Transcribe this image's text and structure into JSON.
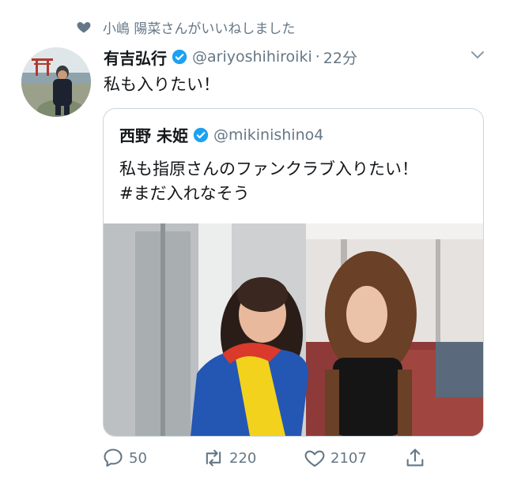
{
  "social_context": {
    "text": "小嶋 陽菜さんがいいねしました",
    "icon": "heart-icon"
  },
  "tweet": {
    "author_name": "有吉弘行",
    "handle": "@ariyoshihiroiki",
    "separator": "·",
    "time": "22分",
    "text": "私も入りたい！",
    "verified": true
  },
  "quoted_tweet": {
    "author_name": "西野 未姫",
    "handle": "@mikinishino4",
    "text_line1": "私も指原さんのファンクラブ入りたい！",
    "text_line2": "#まだ入れなそう",
    "verified": true
  },
  "actions": {
    "reply_count": "50",
    "retweet_count": "220",
    "like_count": "2107"
  },
  "colors": {
    "verified": "#1da1f2",
    "secondary_text": "#657786",
    "border": "#ccd6dd"
  }
}
